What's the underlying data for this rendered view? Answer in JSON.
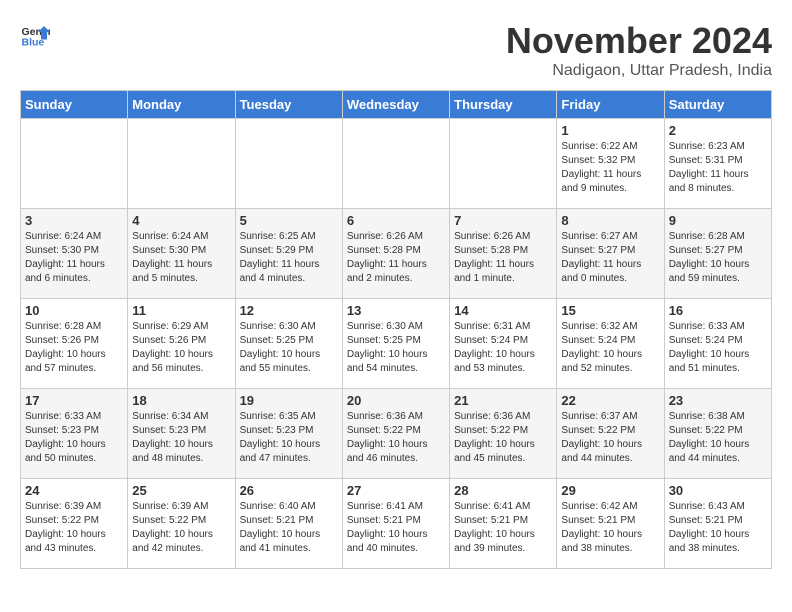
{
  "logo": {
    "general": "General",
    "blue": "Blue"
  },
  "title": "November 2024",
  "subtitle": "Nadigaon, Uttar Pradesh, India",
  "headers": [
    "Sunday",
    "Monday",
    "Tuesday",
    "Wednesday",
    "Thursday",
    "Friday",
    "Saturday"
  ],
  "weeks": [
    [
      {
        "day": "",
        "lines": []
      },
      {
        "day": "",
        "lines": []
      },
      {
        "day": "",
        "lines": []
      },
      {
        "day": "",
        "lines": []
      },
      {
        "day": "",
        "lines": []
      },
      {
        "day": "1",
        "lines": [
          "Sunrise: 6:22 AM",
          "Sunset: 5:32 PM",
          "Daylight: 11 hours",
          "and 9 minutes."
        ]
      },
      {
        "day": "2",
        "lines": [
          "Sunrise: 6:23 AM",
          "Sunset: 5:31 PM",
          "Daylight: 11 hours",
          "and 8 minutes."
        ]
      }
    ],
    [
      {
        "day": "3",
        "lines": [
          "Sunrise: 6:24 AM",
          "Sunset: 5:30 PM",
          "Daylight: 11 hours",
          "and 6 minutes."
        ]
      },
      {
        "day": "4",
        "lines": [
          "Sunrise: 6:24 AM",
          "Sunset: 5:30 PM",
          "Daylight: 11 hours",
          "and 5 minutes."
        ]
      },
      {
        "day": "5",
        "lines": [
          "Sunrise: 6:25 AM",
          "Sunset: 5:29 PM",
          "Daylight: 11 hours",
          "and 4 minutes."
        ]
      },
      {
        "day": "6",
        "lines": [
          "Sunrise: 6:26 AM",
          "Sunset: 5:28 PM",
          "Daylight: 11 hours",
          "and 2 minutes."
        ]
      },
      {
        "day": "7",
        "lines": [
          "Sunrise: 6:26 AM",
          "Sunset: 5:28 PM",
          "Daylight: 11 hours",
          "and 1 minute."
        ]
      },
      {
        "day": "8",
        "lines": [
          "Sunrise: 6:27 AM",
          "Sunset: 5:27 PM",
          "Daylight: 11 hours",
          "and 0 minutes."
        ]
      },
      {
        "day": "9",
        "lines": [
          "Sunrise: 6:28 AM",
          "Sunset: 5:27 PM",
          "Daylight: 10 hours",
          "and 59 minutes."
        ]
      }
    ],
    [
      {
        "day": "10",
        "lines": [
          "Sunrise: 6:28 AM",
          "Sunset: 5:26 PM",
          "Daylight: 10 hours",
          "and 57 minutes."
        ]
      },
      {
        "day": "11",
        "lines": [
          "Sunrise: 6:29 AM",
          "Sunset: 5:26 PM",
          "Daylight: 10 hours",
          "and 56 minutes."
        ]
      },
      {
        "day": "12",
        "lines": [
          "Sunrise: 6:30 AM",
          "Sunset: 5:25 PM",
          "Daylight: 10 hours",
          "and 55 minutes."
        ]
      },
      {
        "day": "13",
        "lines": [
          "Sunrise: 6:30 AM",
          "Sunset: 5:25 PM",
          "Daylight: 10 hours",
          "and 54 minutes."
        ]
      },
      {
        "day": "14",
        "lines": [
          "Sunrise: 6:31 AM",
          "Sunset: 5:24 PM",
          "Daylight: 10 hours",
          "and 53 minutes."
        ]
      },
      {
        "day": "15",
        "lines": [
          "Sunrise: 6:32 AM",
          "Sunset: 5:24 PM",
          "Daylight: 10 hours",
          "and 52 minutes."
        ]
      },
      {
        "day": "16",
        "lines": [
          "Sunrise: 6:33 AM",
          "Sunset: 5:24 PM",
          "Daylight: 10 hours",
          "and 51 minutes."
        ]
      }
    ],
    [
      {
        "day": "17",
        "lines": [
          "Sunrise: 6:33 AM",
          "Sunset: 5:23 PM",
          "Daylight: 10 hours",
          "and 50 minutes."
        ]
      },
      {
        "day": "18",
        "lines": [
          "Sunrise: 6:34 AM",
          "Sunset: 5:23 PM",
          "Daylight: 10 hours",
          "and 48 minutes."
        ]
      },
      {
        "day": "19",
        "lines": [
          "Sunrise: 6:35 AM",
          "Sunset: 5:23 PM",
          "Daylight: 10 hours",
          "and 47 minutes."
        ]
      },
      {
        "day": "20",
        "lines": [
          "Sunrise: 6:36 AM",
          "Sunset: 5:22 PM",
          "Daylight: 10 hours",
          "and 46 minutes."
        ]
      },
      {
        "day": "21",
        "lines": [
          "Sunrise: 6:36 AM",
          "Sunset: 5:22 PM",
          "Daylight: 10 hours",
          "and 45 minutes."
        ]
      },
      {
        "day": "22",
        "lines": [
          "Sunrise: 6:37 AM",
          "Sunset: 5:22 PM",
          "Daylight: 10 hours",
          "and 44 minutes."
        ]
      },
      {
        "day": "23",
        "lines": [
          "Sunrise: 6:38 AM",
          "Sunset: 5:22 PM",
          "Daylight: 10 hours",
          "and 44 minutes."
        ]
      }
    ],
    [
      {
        "day": "24",
        "lines": [
          "Sunrise: 6:39 AM",
          "Sunset: 5:22 PM",
          "Daylight: 10 hours",
          "and 43 minutes."
        ]
      },
      {
        "day": "25",
        "lines": [
          "Sunrise: 6:39 AM",
          "Sunset: 5:22 PM",
          "Daylight: 10 hours",
          "and 42 minutes."
        ]
      },
      {
        "day": "26",
        "lines": [
          "Sunrise: 6:40 AM",
          "Sunset: 5:21 PM",
          "Daylight: 10 hours",
          "and 41 minutes."
        ]
      },
      {
        "day": "27",
        "lines": [
          "Sunrise: 6:41 AM",
          "Sunset: 5:21 PM",
          "Daylight: 10 hours",
          "and 40 minutes."
        ]
      },
      {
        "day": "28",
        "lines": [
          "Sunrise: 6:41 AM",
          "Sunset: 5:21 PM",
          "Daylight: 10 hours",
          "and 39 minutes."
        ]
      },
      {
        "day": "29",
        "lines": [
          "Sunrise: 6:42 AM",
          "Sunset: 5:21 PM",
          "Daylight: 10 hours",
          "and 38 minutes."
        ]
      },
      {
        "day": "30",
        "lines": [
          "Sunrise: 6:43 AM",
          "Sunset: 5:21 PM",
          "Daylight: 10 hours",
          "and 38 minutes."
        ]
      }
    ]
  ]
}
